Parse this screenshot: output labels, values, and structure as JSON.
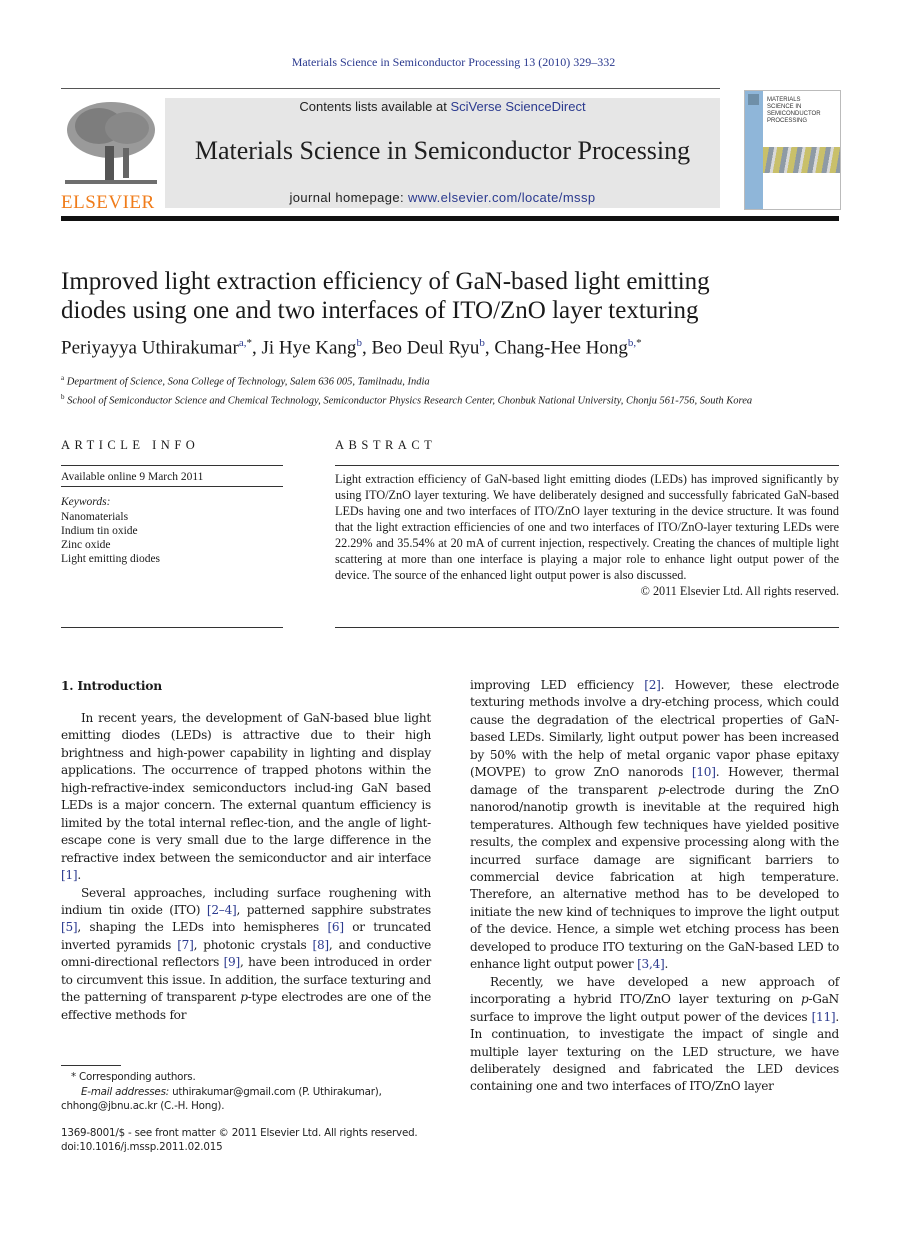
{
  "running_head": "Materials Science in Semiconductor Processing 13 (2010) 329–332",
  "masthead": {
    "publisher_logo": "ELSEVIER",
    "contents_prefix": "Contents lists available at ",
    "contents_link": "SciVerse ScienceDirect",
    "journal_name": "Materials Science in Semiconductor Processing",
    "homepage_prefix": "journal homepage: ",
    "homepage_link": "www.elsevier.com/locate/mssp",
    "cover_title_lines": [
      "MATERIALS",
      "SCIENCE IN",
      "SEMICONDUCTOR",
      "PROCESSING"
    ]
  },
  "article": {
    "title_line1": "Improved light extraction efficiency of GaN-based light emitting",
    "title_line2": "diodes using one and two interfaces of ITO/ZnO layer texturing",
    "authors": [
      {
        "name": "Periyayya Uthirakumar",
        "sup": "a,",
        "star": "*",
        "sep": ", "
      },
      {
        "name": "Ji Hye Kang",
        "sup": "b",
        "star": "",
        "sep": ", "
      },
      {
        "name": "Beo Deul Ryu",
        "sup": "b",
        "star": "",
        "sep": ", "
      },
      {
        "name": "Chang-Hee Hong",
        "sup": "b,",
        "star": "*",
        "sep": ""
      }
    ],
    "affiliations": [
      {
        "mark": "a",
        "text": "Department of Science, Sona College of Technology, Salem 636 005, Tamilnadu, India"
      },
      {
        "mark": "b",
        "text": "School of Semiconductor Science and Chemical Technology, Semiconductor Physics Research Center, Chonbuk National University, Chonju 561-756, South Korea"
      }
    ]
  },
  "article_info": {
    "heading": "ARTICLE INFO",
    "available_online": "Available online 9 March 2011",
    "keywords_label": "Keywords:",
    "keywords": [
      "Nanomaterials",
      "Indium tin oxide",
      "Zinc oxide",
      "Light emitting diodes"
    ]
  },
  "abstract": {
    "heading": "ABSTRACT",
    "text": "Light extraction efficiency of GaN-based light emitting diodes (LEDs) has improved significantly by using ITO/ZnO layer texturing. We have deliberately designed and successfully fabricated GaN-based LEDs having one and two interfaces of ITO/ZnO layer texturing in the device structure. It was found that the light extraction efficiencies of one and two interfaces of ITO/ZnO-layer texturing LEDs were 22.29% and 35.54% at 20 mA of current injection, respectively. Creating the chances of multiple light scattering at more than one interface is playing a major role to enhance light output power of the device. The source of the enhanced light output power is also discussed.",
    "copyright": "© 2011 Elsevier Ltd. All rights reserved."
  },
  "body": {
    "section_heading": "1.  Introduction",
    "left_paragraphs": [
      [
        {
          "t": "In recent years, the development of GaN-based blue light emitting diodes (LEDs) is attractive due to their high brightness and high-power capability in lighting and display applications. The occurrence of trapped photons within the high-refractive-index semiconductors includ-ing GaN based LEDs is a major concern. The external quantum efficiency is limited by the total internal reflec-tion, and the angle of light-escape cone is very small due to the large difference in the refractive index between the semiconductor and air interface "
        },
        {
          "t": "[1]",
          "ref": true
        },
        {
          "t": "."
        }
      ],
      [
        {
          "t": "Several approaches, including surface roughening with indium tin oxide (ITO) "
        },
        {
          "t": "[2–4]",
          "ref": true
        },
        {
          "t": ", patterned sapphire substrates "
        },
        {
          "t": "[5]",
          "ref": true
        },
        {
          "t": ", shaping the LEDs into hemispheres "
        },
        {
          "t": "[6]",
          "ref": true
        },
        {
          "t": " or truncated inverted pyramids "
        },
        {
          "t": "[7]",
          "ref": true
        },
        {
          "t": ", photonic crystals "
        },
        {
          "t": "[8]",
          "ref": true
        },
        {
          "t": ", and conductive omni-directional reflectors "
        },
        {
          "t": "[9]",
          "ref": true
        },
        {
          "t": ", have been introduced in order to circumvent this issue. In addition, the surface texturing and the patterning of transparent "
        },
        {
          "t": "p",
          "it": true
        },
        {
          "t": "-type electrodes are one of the effective methods for"
        }
      ]
    ],
    "right_paragraphs": [
      [
        {
          "t": "improving LED efficiency "
        },
        {
          "t": "[2]",
          "ref": true
        },
        {
          "t": ". However, these electrode texturing methods involve a dry-etching process, which could cause the degradation of the electrical properties of GaN-based LEDs. Similarly, light output power has been increased by 50% with the help of metal organic vapor phase epitaxy (MOVPE) to grow ZnO nanorods "
        },
        {
          "t": "[10]",
          "ref": true
        },
        {
          "t": ". However, thermal damage of the transparent "
        },
        {
          "t": "p",
          "it": true
        },
        {
          "t": "-electrode during the ZnO nanorod/nanotip growth is inevitable at the required high temperatures. Although few techniques have yielded positive results, the complex and expensive processing along with the incurred surface damage are significant barriers to commercial device fabrication at high temperature. Therefore, an alternative method has to be developed to initiate the new kind of techniques to improve the light output of the device. Hence, a simple wet etching process has been developed to produce ITO texturing on the GaN-based LED to enhance light output power "
        },
        {
          "t": "[3,4]",
          "ref": true
        },
        {
          "t": "."
        }
      ],
      [
        {
          "t": "Recently, we have developed a new approach of incorporating a hybrid ITO/ZnO layer texturing on "
        },
        {
          "t": "p",
          "it": true
        },
        {
          "t": "-GaN surface to improve the light output power of the devices "
        },
        {
          "t": "[11]",
          "ref": true
        },
        {
          "t": ". In continuation, to investigate the impact of single and multiple layer texturing on the LED structure, we have deliberately designed and fabricated the LED devices containing one and two interfaces of ITO/ZnO layer"
        }
      ]
    ]
  },
  "footnotes": {
    "corresponding": "* Corresponding authors.",
    "email_label": "E-mail addresses:",
    "email_line1": " uthirakumar@gmail.com (P. Uthirakumar),",
    "email_line2": "chhong@jbnu.ac.kr (C.-H. Hong).",
    "issn": "1369-8001/$ - see front matter © 2011 Elsevier Ltd. All rights reserved.",
    "doi": "doi:10.1016/j.mssp.2011.02.015"
  },
  "colors": {
    "link": "#2b3a8f",
    "elsevier_orange": "#f07c1a",
    "masthead_gray": "#e6e6e6"
  }
}
